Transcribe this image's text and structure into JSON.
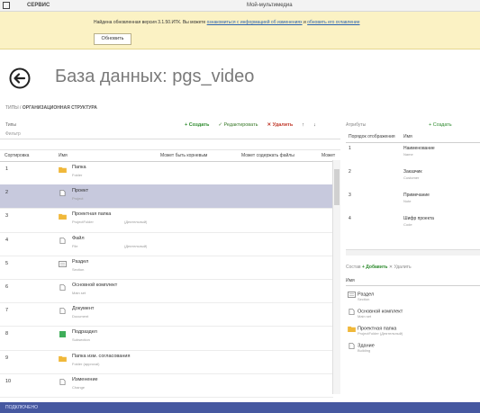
{
  "titlebar": {
    "menu": "СЕРВИС",
    "window_title": "Мой-мультимедиа"
  },
  "banner": {
    "message_start": "Найдена обновленная версия 3.1.50.ИТК. Вы можете",
    "link1": "ознакомиться с информацией об изменениях",
    "message_mid": "и",
    "link2": "обновить его оглавление",
    "button": "Обновить"
  },
  "page": {
    "title": "База данных: pgs_video"
  },
  "breadcrumb": {
    "root": "ТИПЫ",
    "current": "ОРГАНИЗАЦИОННАЯ СТРУКТУРА"
  },
  "left": {
    "section_label": "Типы",
    "filter_placeholder": "Фильтр",
    "toolbar": {
      "create": "+ Создать",
      "edit": "✓ Редактировать",
      "delete": "✕ Удалить"
    },
    "columns": [
      "Сортировка",
      "Имя",
      "Может быть корневым",
      "Может содержать файлы",
      "Может"
    ],
    "rows": [
      {
        "sort": "1",
        "name": "Папка",
        "sub": "Folder",
        "sub2": "",
        "icon": "folder"
      },
      {
        "sort": "2",
        "name": "Проект",
        "sub": "Project",
        "sub2": "",
        "icon": "doc",
        "selected": true
      },
      {
        "sort": "3",
        "name": "Проектная папка",
        "sub": "ProjectFolder",
        "sub2": "(Деятельный)",
        "icon": "folder"
      },
      {
        "sort": "4",
        "name": "Файл",
        "sub": "File",
        "sub2": "(Деятельный)",
        "icon": "doc"
      },
      {
        "sort": "5",
        "name": "Раздел",
        "sub": "Section",
        "sub2": "",
        "icon": "section"
      },
      {
        "sort": "6",
        "name": "Основной комплект",
        "sub": "Main set",
        "sub2": "",
        "icon": "doc"
      },
      {
        "sort": "7",
        "name": "Документ",
        "sub": "Document",
        "sub2": "",
        "icon": "doc"
      },
      {
        "sort": "8",
        "name": "Подраздел",
        "sub": "Subsection",
        "sub2": "",
        "icon": "green"
      },
      {
        "sort": "9",
        "name": "Папка изм. согласования",
        "sub": "Folder (approval)",
        "sub2": "",
        "icon": "folder"
      },
      {
        "sort": "10",
        "name": "Изменение",
        "sub": "Change",
        "sub2": "",
        "icon": "doc"
      }
    ]
  },
  "right": {
    "section_label": "Атрибуты",
    "create": "+ Создать",
    "columns": [
      "Порядок отображения",
      "Имя"
    ],
    "rows": [
      {
        "n": "1",
        "name": "Наименование",
        "sub": "Name"
      },
      {
        "n": "2",
        "name": "Заказчик",
        "sub": "Customer"
      },
      {
        "n": "3",
        "name": "Примечание",
        "sub": "Note"
      },
      {
        "n": "4",
        "name": "Шифр проекта",
        "sub": "Code"
      }
    ],
    "toolbar2": {
      "label": "Состав",
      "add": "+ Добавить",
      "remove": "✕ Удалить"
    },
    "list_header": "Имя",
    "list": [
      {
        "name": "Раздел",
        "sub": "Section",
        "icon": "section"
      },
      {
        "name": "Основной комплект",
        "sub": "Main set",
        "icon": "doc"
      },
      {
        "name": "Проектная папка",
        "sub": "ProjectFolder (Деятельный)",
        "icon": "folder"
      },
      {
        "name": "Здание",
        "sub": "Building",
        "icon": "doc"
      }
    ]
  },
  "status": {
    "text": "ПОДКЛЮЧЕНО"
  },
  "colors": {
    "accent": "#4658a0",
    "selected_row": "#c7c9dd",
    "banner": "#fbf2c4",
    "folder": "#f0b83a",
    "add": "#2e8b2e",
    "delete": "#c0392b"
  }
}
